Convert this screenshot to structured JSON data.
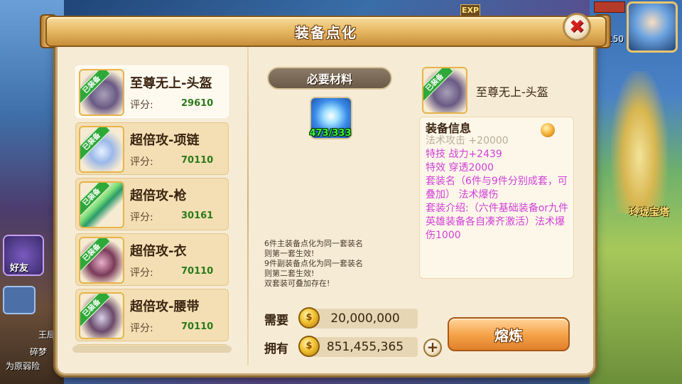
{
  "background": {
    "exp_tag": "EXP",
    "hero_stat": "150",
    "tower_label": "玲珑宝塔",
    "friend_label": "好友",
    "chat_lines": [
      "王局",
      "碎梦",
      "为原弱险"
    ]
  },
  "dialog": {
    "title": "装备点化",
    "close_icon": "✖"
  },
  "equipment_list": [
    {
      "name": "至尊无上-头盔",
      "score_label": "评分:",
      "score": "29610",
      "equipped": "已装备",
      "icon": "helmet-icon",
      "selected": true
    },
    {
      "name": "超倍攻-项链",
      "score_label": "评分:",
      "score": "70110",
      "equipped": "已装备",
      "icon": "necklace-icon",
      "selected": false
    },
    {
      "name": "超倍攻-枪",
      "score_label": "评分:",
      "score": "30161",
      "equipped": "已装备",
      "icon": "spear-icon",
      "selected": false
    },
    {
      "name": "超倍攻-衣",
      "score_label": "评分:",
      "score": "70110",
      "equipped": "已装备",
      "icon": "armor-icon",
      "selected": false
    },
    {
      "name": "超倍攻-腰带",
      "score_label": "评分:",
      "score": "70110",
      "equipped": "已装备",
      "icon": "belt-icon",
      "selected": false
    }
  ],
  "materials": {
    "header": "必要材料",
    "icon": "crystal-material-icon",
    "count": "473/333"
  },
  "rules": [
    "6件主装备点化为同一套装名",
    "则第一套生效!",
    "9件副装备点化为同一套装名",
    "则第二套生效!",
    "双套装可叠加存在!"
  ],
  "cost": {
    "need_label": "需要",
    "need_value": "20,000,000",
    "own_label": "拥有",
    "own_value": "851,455,365",
    "coin_glyph": "$",
    "plus": "+"
  },
  "selected_info": {
    "name": "至尊无上-头盔",
    "equipped": "已装备",
    "section_title": "装备信息",
    "faded_line": "法术攻击 +20000",
    "lines": [
      "特技  战力+2439",
      "特效  穿透2000",
      "套装名（6件与9件分别成套，可叠加）  法术爆伤",
      "套装介绍:（六件基础装备or九件英雄装备各自凑齐激活）法术爆伤1000"
    ]
  },
  "actions": {
    "smelt_label": "熔炼"
  },
  "colors": {
    "accent_gold": "#e8bb66",
    "info_purple": "#d040d8",
    "score_green": "#2a7a1a",
    "equipped_green": "#2fa83a"
  }
}
